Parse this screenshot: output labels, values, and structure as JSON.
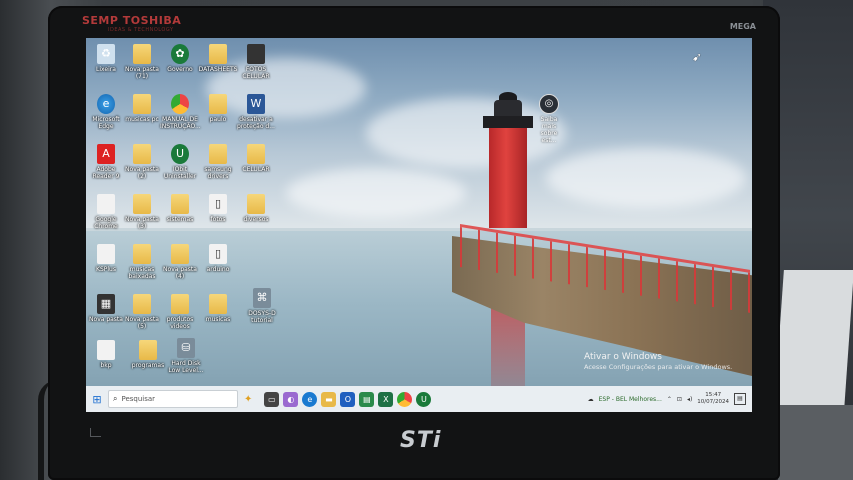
{
  "monitor": {
    "brand_top": "SEMP TOSHIBA",
    "brand_sub": "IDEAS & TECHNOLOGY",
    "model_tag": "MEGA",
    "brand_bottom": "STi"
  },
  "desktop": {
    "icons": [
      {
        "label": "Lixeira",
        "icon": "recycle-bin-icon"
      },
      {
        "label": "Nova pasta (71)",
        "icon": "folder-icon"
      },
      {
        "label": "Governo",
        "icon": "app-icon"
      },
      {
        "label": "DATASHEETS",
        "icon": "folder-icon"
      },
      {
        "label": "FOTOS CELULAR",
        "icon": "folder-icon"
      },
      {
        "label": "Microsoft Edge",
        "icon": "edge-icon"
      },
      {
        "label": "musicas pc",
        "icon": "folder-icon"
      },
      {
        "label": "MANUAL DE INSTRUÇÃO...",
        "icon": "chrome-icon"
      },
      {
        "label": "paulo",
        "icon": "folder-icon"
      },
      {
        "label": "desativar a proteção d...",
        "icon": "word-doc-icon"
      },
      {
        "label": "Adobe Reader 9",
        "icon": "adobe-pdf-icon"
      },
      {
        "label": "Nova pasta (2)",
        "icon": "folder-icon"
      },
      {
        "label": "IObit Uninstaller",
        "icon": "iobit-icon"
      },
      {
        "label": "samsung drivers",
        "icon": "folder-icon"
      },
      {
        "label": "CELULAR",
        "icon": "folder-icon"
      },
      {
        "label": "Google Chrome",
        "icon": "file-icon"
      },
      {
        "label": "Nova pasta (3)",
        "icon": "folder-icon"
      },
      {
        "label": "sistemas",
        "icon": "folder-icon"
      },
      {
        "label": "fotos",
        "icon": "folder-icon"
      },
      {
        "label": "diversos",
        "icon": "folder-icon"
      },
      {
        "label": "KSPlus",
        "icon": "file-icon"
      },
      {
        "label": "musicas baixadas",
        "icon": "folder-icon"
      },
      {
        "label": "Nova pasta (4)",
        "icon": "folder-icon"
      },
      {
        "label": "arduino",
        "icon": "folder-icon"
      },
      {
        "label": "Nova pasta",
        "icon": "app-icon"
      },
      {
        "label": "Nova pasta (5)",
        "icon": "folder-icon"
      },
      {
        "label": "produtos videos",
        "icon": "folder-icon"
      },
      {
        "label": "musicas",
        "icon": "folder-icon"
      },
      {
        "label": "DOSYS-D tutorial",
        "icon": "app-icon"
      },
      {
        "label": "bkp",
        "icon": "file-icon"
      },
      {
        "label": "programas",
        "icon": "folder-icon"
      },
      {
        "label": "Hard Disk Low Level...",
        "icon": "hard-disk-icon"
      }
    ],
    "learn_more": {
      "label": "Saiba mais sobre est...",
      "icon": "camera-icon"
    }
  },
  "watermark": {
    "title": "Ativar o Windows",
    "subtitle": "Acesse Configurações para ativar o Windows."
  },
  "taskbar": {
    "search_placeholder": "Pesquisar",
    "tray_text": "ESP - BEL Melhores...",
    "time": "15:47",
    "date": "10/07/2024"
  }
}
